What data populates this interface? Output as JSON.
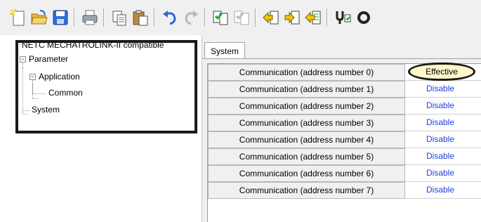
{
  "toolbar": {
    "buttons": [
      "new-file-icon",
      "open-folder-icon",
      "save-icon",
      "print-icon",
      "copy-icon",
      "paste-icon",
      "undo-icon",
      "redo-icon",
      "compile-icon",
      "compile-all-icon",
      "upload-icon",
      "download-icon",
      "compare-icon",
      "transfer-icon",
      "settings-icon"
    ]
  },
  "tree": {
    "root": "NETC MECHATROLINK-II compatible",
    "parameter": "Parameter",
    "application": "Application",
    "common": "Common",
    "system": "System"
  },
  "tabs": {
    "system": "System"
  },
  "rows": [
    {
      "label": "Communication (address number 0)",
      "value": "Effective"
    },
    {
      "label": "Communication (address number 1)",
      "value": "Disable"
    },
    {
      "label": "Communication (address number 2)",
      "value": "Disable"
    },
    {
      "label": "Communication (address number 3)",
      "value": "Disable"
    },
    {
      "label": "Communication (address number 4)",
      "value": "Disable"
    },
    {
      "label": "Communication (address number 5)",
      "value": "Disable"
    },
    {
      "label": "Communication (address number 6)",
      "value": "Disable"
    },
    {
      "label": "Communication (address number 7)",
      "value": "Disable"
    }
  ],
  "colors": {
    "disable_text": "#1e3fdc",
    "effective_bg": "#fdf7c9",
    "highlight_border": "#1a1a1a"
  }
}
